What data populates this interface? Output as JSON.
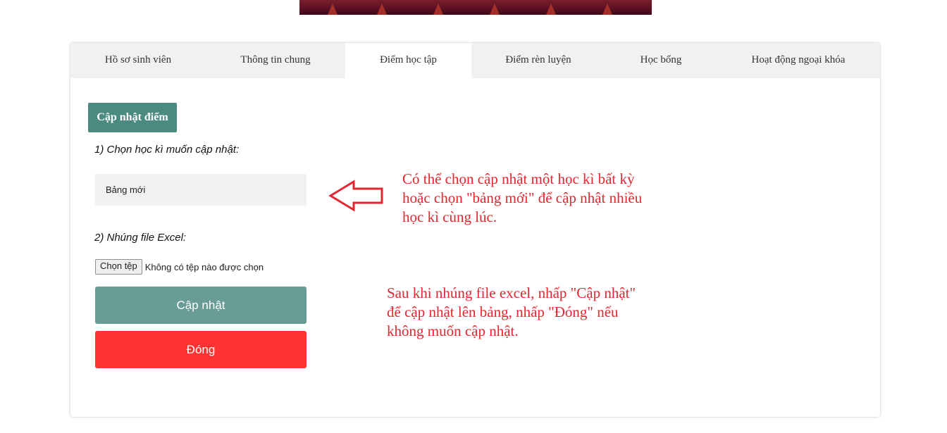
{
  "tabs": [
    {
      "label": "Hồ sơ sinh viên",
      "active": false
    },
    {
      "label": "Thông tin chung",
      "active": false
    },
    {
      "label": "Điểm học tập",
      "active": true
    },
    {
      "label": "Điểm rèn luyện",
      "active": false
    },
    {
      "label": "Học bổng",
      "active": false
    },
    {
      "label": "Hoạt động ngoại khóa",
      "active": false
    }
  ],
  "form": {
    "title": "Cập nhật điểm",
    "step1_label": "1) Chọn học kì muốn cập nhật:",
    "semester_select_value": "Bảng mới",
    "step2_label": "2) Nhúng file Excel:",
    "file_button_label": "Chọn tệp",
    "file_status": "Không có tệp nào được chọn",
    "update_button": "Cập nhật",
    "close_button": "Đóng"
  },
  "notes": {
    "note1_lines": [
      "Có thể chọn cập nhật một học kì bất kỳ",
      "hoặc chọn \"bảng mới\" để cập nhật nhiều",
      "học kì cùng lúc."
    ],
    "note2_lines": [
      "Sau khi nhúng file excel, nhấp \"Cập nhật\"",
      "để cập nhật lên bảng, nhấp \"Đóng\" nếu",
      "không muốn cập nhật."
    ]
  },
  "colors": {
    "accent": "#4a8a80",
    "update_button": "#6a9c96",
    "close_button": "#ff3333",
    "annotation": "#e3262f"
  },
  "icons": {
    "annotation_arrow": "left-arrow-icon"
  }
}
